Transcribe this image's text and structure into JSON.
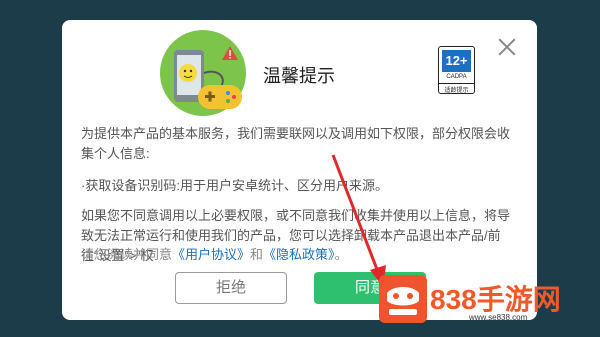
{
  "dialog": {
    "title": "温馨提示",
    "rating": {
      "age": "12+",
      "org": "CADPA",
      "label": "适龄提示"
    },
    "paragraphs": [
      "为提供本产品的基本服务，我们需要联网以及调用如下权限，部分权限会收集个人信息:",
      "·获取设备识别码:用于用户安卓统计、区分用户来源。",
      "如果您不同意调用以上必要权限，或不同意我们收集并使用以上信息，将导致无法正常运行和使用我们的产品，您可以选择卸载本产品退出本产品/前往“设置”>“权"
    ],
    "consent": {
      "prefix": "请您阅读并同意",
      "user_agreement": "《用户协议》",
      "and": "和",
      "privacy_policy": "《隐私政策》",
      "suffix": "。"
    },
    "reject_label": "拒绝",
    "agree_label": "同意"
  },
  "watermark": {
    "brand": "838手游网",
    "url": "www.se838.com"
  },
  "colors": {
    "background": "#1d3c4a",
    "agree_button": "#2ebf6f",
    "link": "#1a70b8",
    "annotation_arrow": "#e0282b",
    "watermark": "#f05a2a"
  }
}
